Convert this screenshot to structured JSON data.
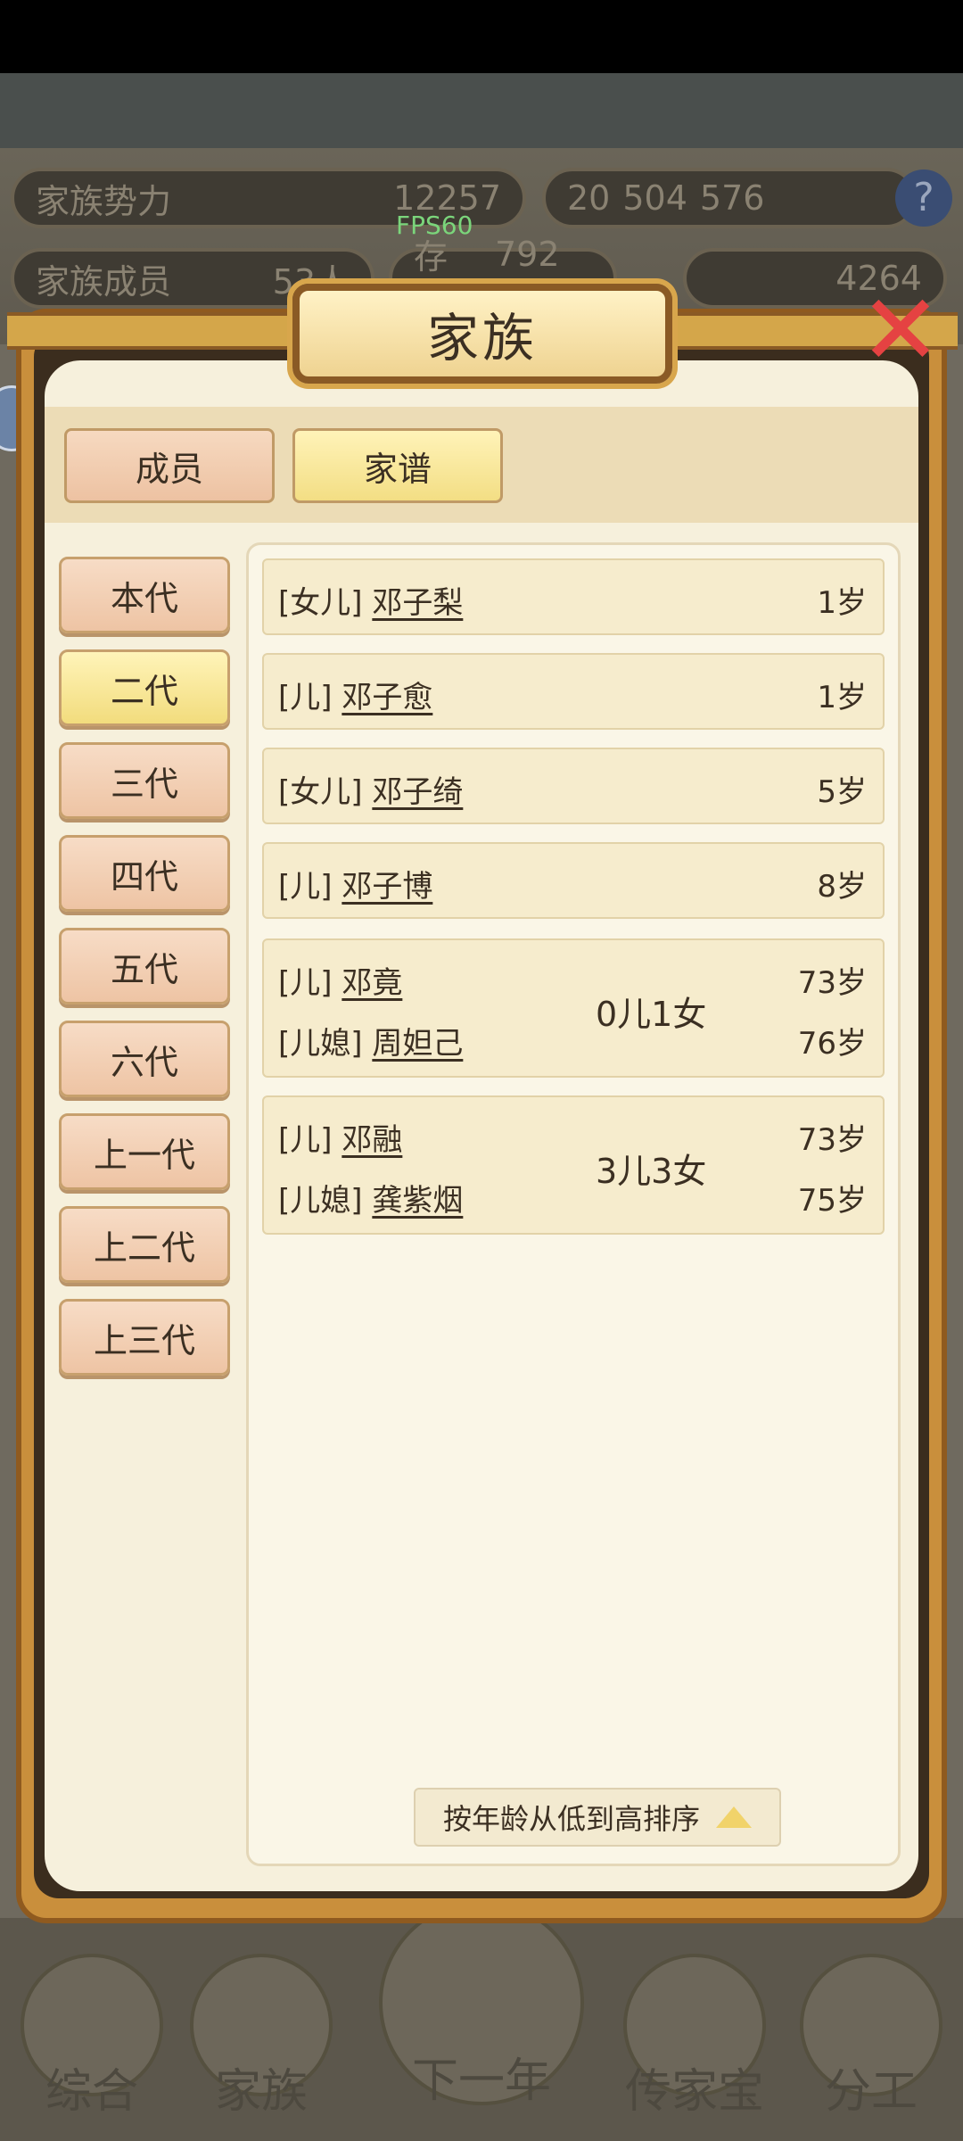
{
  "hud": {
    "power_label": "家族势力",
    "power_value": "12257",
    "members_label": "家族成员",
    "members_value": "53人",
    "exist_label": "存世",
    "exist_value": "792年",
    "res1": "20",
    "res2": "504",
    "res3": "576",
    "gold": "4264",
    "fps": "FPS60"
  },
  "dialog": {
    "title": "家族",
    "close_icon": "close-icon"
  },
  "tabs": [
    {
      "label": "成员",
      "active": false
    },
    {
      "label": "家谱",
      "active": true
    }
  ],
  "generations": [
    {
      "label": "本代",
      "active": false
    },
    {
      "label": "二代",
      "active": true
    },
    {
      "label": "三代",
      "active": false
    },
    {
      "label": "四代",
      "active": false
    },
    {
      "label": "五代",
      "active": false
    },
    {
      "label": "六代",
      "active": false
    },
    {
      "label": "上一代",
      "active": false
    },
    {
      "label": "上二代",
      "active": false
    },
    {
      "label": "上三代",
      "active": false
    }
  ],
  "members": [
    {
      "relation": "[女儿]",
      "name": "邓子梨",
      "age": "1岁"
    },
    {
      "relation": "[儿]",
      "name": "邓子愈",
      "age": "1岁"
    },
    {
      "relation": "[女儿]",
      "name": "邓子绮",
      "age": "5岁"
    },
    {
      "relation": "[儿]",
      "name": "邓子博",
      "age": "8岁"
    },
    {
      "relation": "[儿]",
      "name": "邓竟",
      "age": "73岁",
      "spouse_relation": "[儿媳]",
      "spouse_name": "周妲己",
      "spouse_age": "76岁",
      "children": "0儿1女"
    },
    {
      "relation": "[儿]",
      "name": "邓融",
      "age": "73岁",
      "spouse_relation": "[儿媳]",
      "spouse_name": "龚紫烟",
      "spouse_age": "75岁",
      "children": "3儿3女"
    }
  ],
  "sort_button": "按年龄从低到高排序",
  "nav": [
    {
      "label": "综合"
    },
    {
      "label": "家族"
    },
    {
      "label": "下一年"
    },
    {
      "label": "传家宝"
    },
    {
      "label": "分工"
    }
  ],
  "colors": {
    "tab_active": "#f3de84",
    "tab_inactive": "#edc2a2",
    "panel": "#faf6e7",
    "close": "#e54242"
  }
}
